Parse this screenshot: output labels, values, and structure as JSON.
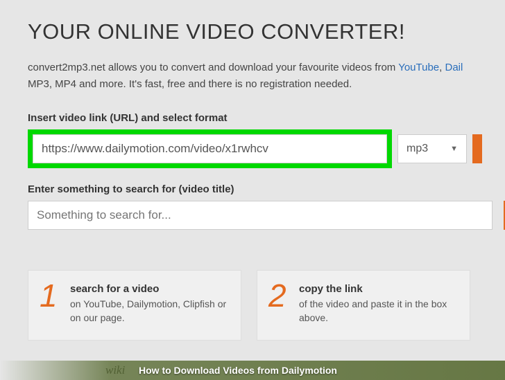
{
  "headline": "YOUR ONLINE VIDEO CONVERTER!",
  "intro": {
    "part1": "convert2mp3.net allows you to convert and download your favourite videos from ",
    "link1": "YouTube",
    "sep": ", ",
    "link2": "Dail",
    "part2": "MP3, MP4 and more. It's fast, free and there is no registration needed."
  },
  "url_section": {
    "label": "Insert video link (URL) and select format",
    "value": "https://www.dailymotion.com/video/x1rwhcv",
    "format": "mp3"
  },
  "search_section": {
    "label": "Enter something to search for (video title)",
    "placeholder": "Something to search for..."
  },
  "steps": [
    {
      "num": "1",
      "title": "search for a video",
      "body": "on YouTube, Dailymotion, Clipfish or on our page."
    },
    {
      "num": "2",
      "title": "copy the link",
      "body": "of the video and paste it in the box above."
    }
  ],
  "footer": {
    "wiki": "wiki",
    "title": "How to Download Videos from Dailymotion"
  }
}
